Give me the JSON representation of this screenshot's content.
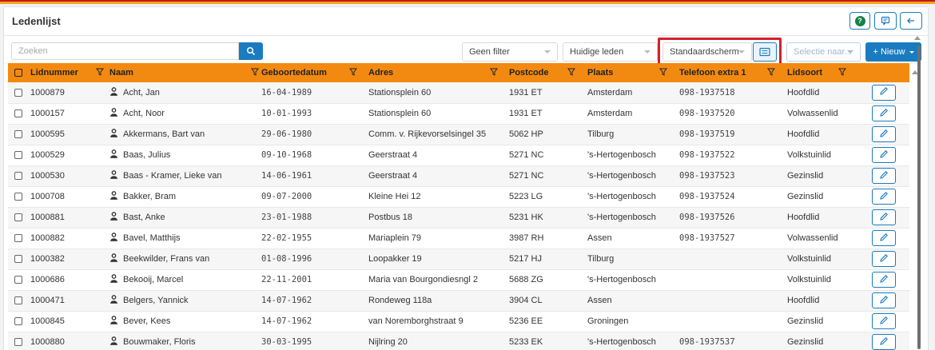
{
  "page": {
    "title": "Ledenlijst"
  },
  "header": {
    "help_icon": "question-circle-icon",
    "chat_icon": "comment-icon",
    "back_icon": "arrow-left-icon"
  },
  "toolbar": {
    "search_placeholder": "Zoeken",
    "search_icon": "search-icon",
    "filter_select": "Geen filter",
    "members_select": "Huidige leden",
    "screen_select": "Standaardscherm",
    "screen_button_icon": "list-icon",
    "selection_select": "Selectie naar...",
    "new_button": "+ Nieuw"
  },
  "colors": {
    "accent": "#1a7bc0",
    "header_orange": "#f28a12",
    "highlight_red": "#d4202c"
  },
  "table": {
    "columns": [
      "Lidnummer",
      "Naam",
      "Geboortedatum",
      "Adres",
      "Postcode",
      "Plaats",
      "Telefoon extra 1",
      "Lidsoort"
    ],
    "rows": [
      {
        "lidnummer": "1000879",
        "naam": "Acht, Jan",
        "geboortedatum": "16-04-1989",
        "adres": "Stationsplein 60",
        "postcode": "1931 ET",
        "plaats": "Amsterdam",
        "telefoon": "098-1937518",
        "lidsoort": "Hoofdlid"
      },
      {
        "lidnummer": "1000157",
        "naam": "Acht, Noor",
        "geboortedatum": "10-01-1993",
        "adres": "Stationsplein 60",
        "postcode": "1931 ET",
        "plaats": "Amsterdam",
        "telefoon": "098-1937520",
        "lidsoort": "Volwassenlid"
      },
      {
        "lidnummer": "1000595",
        "naam": "Akkermans, Bart van",
        "geboortedatum": "29-06-1980",
        "adres": "Comm. v. Rijkevorselsingel 35",
        "postcode": "5062 HP",
        "plaats": "Tilburg",
        "telefoon": "098-1937519",
        "lidsoort": "Hoofdlid"
      },
      {
        "lidnummer": "1000529",
        "naam": "Baas, Julius",
        "geboortedatum": "09-10-1968",
        "adres": "Geerstraat 4",
        "postcode": "5271 NC",
        "plaats": "'s-Hertogenbosch",
        "telefoon": "098-1937522",
        "lidsoort": "Volkstuinlid"
      },
      {
        "lidnummer": "1000530",
        "naam": "Baas - Kramer, Lieke van",
        "geboortedatum": "14-06-1961",
        "adres": "Geerstraat 4",
        "postcode": "5271 NC",
        "plaats": "'s-Hertogenbosch",
        "telefoon": "098-1937523",
        "lidsoort": "Gezinslid"
      },
      {
        "lidnummer": "1000708",
        "naam": "Bakker, Bram",
        "geboortedatum": "09-07-2000",
        "adres": "Kleine Hei 12",
        "postcode": "5223 LG",
        "plaats": "'s-Hertogenbosch",
        "telefoon": "098-1937524",
        "lidsoort": "Gezinslid"
      },
      {
        "lidnummer": "1000881",
        "naam": "Bast, Anke",
        "geboortedatum": "23-01-1988",
        "adres": "Postbus 18",
        "postcode": "5231 HK",
        "plaats": "'s-Hertogenbosch",
        "telefoon": "098-1937526",
        "lidsoort": "Hoofdlid"
      },
      {
        "lidnummer": "1000882",
        "naam": "Bavel, Matthijs",
        "geboortedatum": "22-02-1955",
        "adres": "Mariaplein 79",
        "postcode": "3987 RH",
        "plaats": "Assen",
        "telefoon": "098-1937527",
        "lidsoort": "Volwassenlid"
      },
      {
        "lidnummer": "1000382",
        "naam": "Beekwilder, Frans van",
        "geboortedatum": "01-08-1996",
        "adres": "Loopakker 19",
        "postcode": "5217 HJ",
        "plaats": "Tilburg",
        "telefoon": "",
        "lidsoort": "Volkstuinlid"
      },
      {
        "lidnummer": "1000686",
        "naam": "Bekooij, Marcel",
        "geboortedatum": "22-11-2001",
        "adres": "Maria van Bourgondiesngl 2",
        "postcode": "5688 ZG",
        "plaats": "'s-Hertogenbosch",
        "telefoon": "",
        "lidsoort": "Volkstuinlid"
      },
      {
        "lidnummer": "1000471",
        "naam": "Belgers, Yannick",
        "geboortedatum": "14-07-1962",
        "adres": "Rondeweg 118a",
        "postcode": "3904 CL",
        "plaats": "Assen",
        "telefoon": "",
        "lidsoort": "Hoofdlid"
      },
      {
        "lidnummer": "1000845",
        "naam": "Bever, Kees",
        "geboortedatum": "14-07-1962",
        "adres": "van Noremborghstraat 9",
        "postcode": "5236 EE",
        "plaats": "Groningen",
        "telefoon": "",
        "lidsoort": "Gezinslid"
      },
      {
        "lidnummer": "1000880",
        "naam": "Bouwmaker, Floris",
        "geboortedatum": "30-03-1995",
        "adres": "Nijlring 20",
        "postcode": "5233 EK",
        "plaats": "'s-Hertogenbosch",
        "telefoon": "098-1937537",
        "lidsoort": "Gezinslid"
      }
    ]
  }
}
